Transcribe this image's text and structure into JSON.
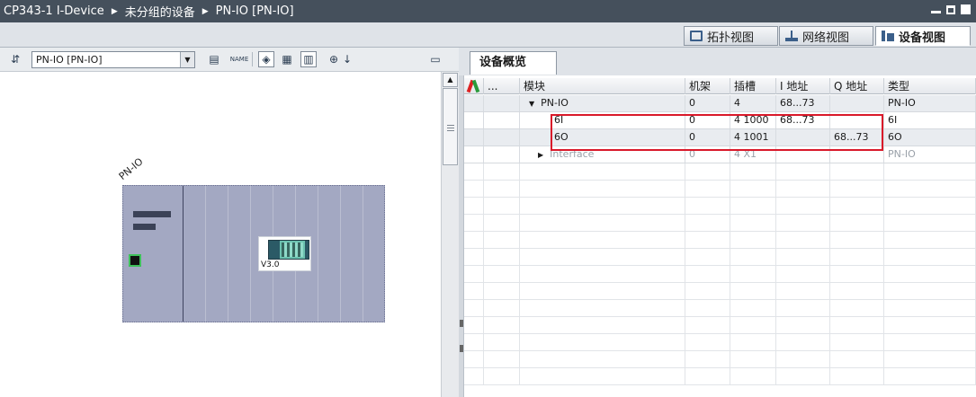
{
  "titlebar": {
    "crumbs": [
      "CP343-1 I-Device",
      "未分组的设备",
      "PN-IO [PN-IO]"
    ]
  },
  "view_tabs": [
    {
      "label": "拓扑视图",
      "icon": "topology-icon"
    },
    {
      "label": "网络视图",
      "icon": "network-icon"
    },
    {
      "label": "设备视图",
      "icon": "device-icon",
      "active": true
    }
  ],
  "left": {
    "device_select": "PN-IO [PN-IO]",
    "device_label": "PN-IO",
    "module_version": "V3.0"
  },
  "right": {
    "tab": "设备概览",
    "columns": [
      "",
      "...",
      "模块",
      "机架",
      "插槽",
      "I 地址",
      "Q 地址",
      "类型"
    ],
    "rows": [
      {
        "module": "PN-IO",
        "rack": "0",
        "slot": "4",
        "i_addr": "68...73",
        "q_addr": "",
        "type": "PN-IO"
      },
      {
        "module": "6I",
        "rack": "0",
        "slot": "4 1000",
        "i_addr": "68...73",
        "q_addr": "",
        "type": "6I"
      },
      {
        "module": "6O",
        "rack": "0",
        "slot": "4 1001",
        "i_addr": "",
        "q_addr": "68...73",
        "type": "6O"
      },
      {
        "module": "Interface",
        "rack": "0",
        "slot": "4 X1",
        "i_addr": "",
        "q_addr": "",
        "type": "PN-IO"
      }
    ]
  },
  "colors": {
    "highlight_box": "#d9192a",
    "rack_fill": "#a3a8c2",
    "titlebar": "#45505c"
  }
}
